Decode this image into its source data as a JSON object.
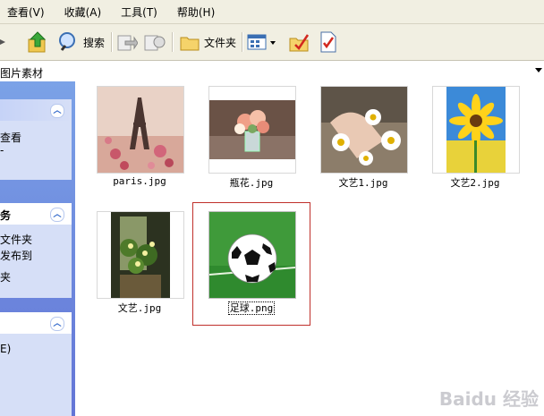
{
  "menubar": {
    "items": [
      "查看(V)",
      "收藏(A)",
      "工具(T)",
      "帮助(H)"
    ]
  },
  "toolbar": {
    "search_label": "搜索",
    "folders_label": "文件夹"
  },
  "address": {
    "path": "图片素材"
  },
  "taskpane": {
    "panel1": {
      "lines": [
        "查看",
        "-"
      ]
    },
    "panel2": {
      "title": "务",
      "lines": [
        "文件夹",
        "发布到",
        "夹"
      ]
    },
    "panel3": {
      "lines": [
        "E)"
      ]
    }
  },
  "files": [
    {
      "name": "paris.jpg"
    },
    {
      "name": "瓶花.jpg"
    },
    {
      "name": "文艺1.jpg"
    },
    {
      "name": "文艺2.jpg"
    },
    {
      "name": "文艺.jpg"
    },
    {
      "name": "足球.png",
      "selected": true
    }
  ],
  "watermark": "Baidu 经验"
}
